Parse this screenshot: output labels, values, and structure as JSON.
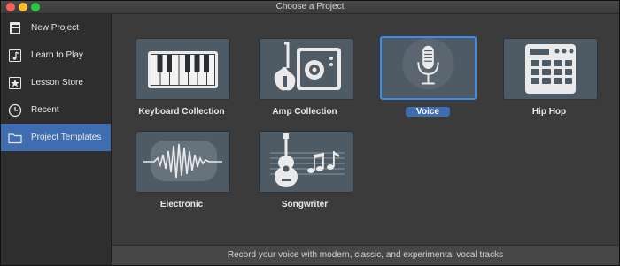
{
  "window": {
    "title": "Choose a Project"
  },
  "sidebar": {
    "items": [
      {
        "label": "New Project",
        "icon": "new-project-icon"
      },
      {
        "label": "Learn to Play",
        "icon": "learn-to-play-icon"
      },
      {
        "label": "Lesson Store",
        "icon": "lesson-store-icon"
      },
      {
        "label": "Recent",
        "icon": "recent-clock-icon"
      },
      {
        "label": "Project Templates",
        "icon": "folder-icon",
        "selected": true
      }
    ]
  },
  "templates": [
    {
      "label": "Keyboard Collection",
      "icon": "keyboard-icon"
    },
    {
      "label": "Amp Collection",
      "icon": "guitar-amp-icon"
    },
    {
      "label": "Voice",
      "icon": "microphone-icon",
      "selected": true
    },
    {
      "label": "Hip Hop",
      "icon": "drum-machine-icon"
    },
    {
      "label": "Electronic",
      "icon": "waveform-icon"
    },
    {
      "label": "Songwriter",
      "icon": "acoustic-guitar-icon"
    }
  ],
  "status": {
    "description": "Record your voice with modern, classic, and experimental vocal tracks"
  },
  "colors": {
    "accent": "#3f6db0",
    "selection_border": "#3f8bea",
    "tile": "#4e5a64"
  }
}
